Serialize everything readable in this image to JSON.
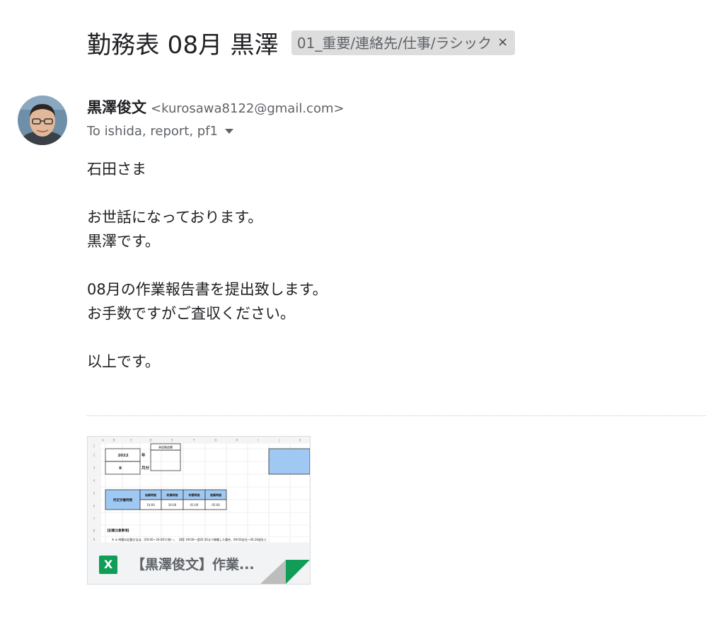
{
  "email": {
    "subject": "勤務表 08月 黒澤",
    "label": "01_重要/連絡先/仕事/ラシック",
    "label_close": "×",
    "sender_name": "黒澤俊文",
    "sender_email": "<kurosawa8122@gmail.com>",
    "to_line": "To ishida, report, pf1",
    "body": {
      "line1": "石田さま",
      "line2": "お世話になっております。",
      "line3": "黒澤です。",
      "line4": "08月の作業報告書を提出致します。",
      "line5": "お手数ですがご査収ください。",
      "line6": "以上です。"
    }
  },
  "attachment": {
    "icon_letter": "X",
    "file_name": "【黒澤俊文】作業...",
    "icon": "excel-icon",
    "accent": "#0f9d58",
    "preview": {
      "col_headers": [
        "A",
        "B",
        "C",
        "D",
        "E",
        "F",
        "G",
        "H",
        "I",
        "J",
        "K"
      ],
      "row_numbers": [
        "1",
        "2",
        "3",
        "4",
        "5",
        "6",
        "7",
        "8",
        "9"
      ],
      "year": "2022",
      "year_label": "年",
      "month": "8",
      "month_label": "月分",
      "approval_label": "承認確認欄",
      "work_hours_label": "所定労働時間",
      "headers": [
        "始業時間",
        "終業時間",
        "休憩時間",
        "就業時間"
      ],
      "times": [
        "10:00",
        "16:00",
        "01:00",
        "05:00"
      ],
      "notes_title": "【記載注意事項】",
      "note1": "※ ① 時間の記載方法は、[00:00～24:00]で統一。 【例】09:00～翌02:30まで稼働した場合、09:00出社～26:30退社と"
    }
  }
}
